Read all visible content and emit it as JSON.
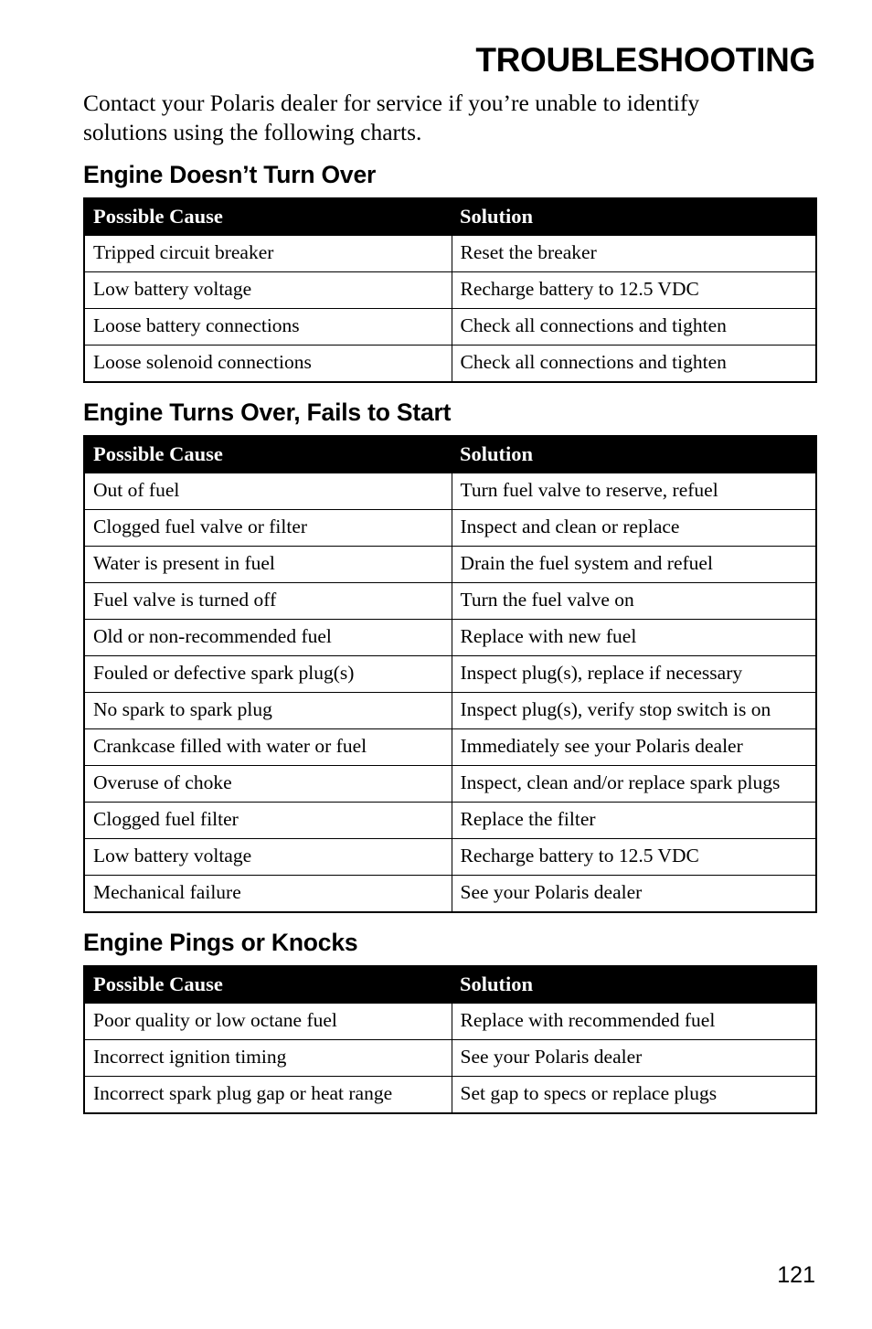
{
  "document": {
    "title": "TROUBLESHOOTING",
    "intro": "Contact your Polaris dealer for service if you’re unable to identify solutions using the following charts.",
    "page_number": "121"
  },
  "table_headers": {
    "cause": "Possible Cause",
    "solution": "Solution"
  },
  "sections": [
    {
      "heading": "Engine Doesn’t Turn Over",
      "rows": [
        {
          "cause": "Tripped circuit breaker",
          "solution": "Reset the breaker"
        },
        {
          "cause": "Low battery voltage",
          "solution": "Recharge battery to 12.5 VDC"
        },
        {
          "cause": "Loose battery connections",
          "solution": "Check all connections and tighten"
        },
        {
          "cause": "Loose solenoid connections",
          "solution": "Check all connections and tighten"
        }
      ]
    },
    {
      "heading": "Engine Turns Over, Fails to Start",
      "rows": [
        {
          "cause": "Out of fuel",
          "solution": "Turn fuel valve to reserve, refuel"
        },
        {
          "cause": "Clogged fuel valve or filter",
          "solution": "Inspect and clean or replace"
        },
        {
          "cause": "Water is present in fuel",
          "solution": "Drain the fuel system and refuel"
        },
        {
          "cause": "Fuel valve is turned off",
          "solution": "Turn the fuel valve on"
        },
        {
          "cause": "Old or non-recommended fuel",
          "solution": "Replace with new fuel"
        },
        {
          "cause": "Fouled or defective spark plug(s)",
          "solution": "Inspect plug(s), replace if necessary"
        },
        {
          "cause": "No spark to spark plug",
          "solution": "Inspect plug(s), verify stop switch is on"
        },
        {
          "cause": "Crankcase filled with water or fuel",
          "solution": "Immediately see your Polaris dealer"
        },
        {
          "cause": "Overuse of choke",
          "solution": "Inspect, clean and/or replace spark plugs"
        },
        {
          "cause": "Clogged fuel filter",
          "solution": "Replace the filter"
        },
        {
          "cause": "Low battery voltage",
          "solution": "Recharge battery to 12.5 VDC"
        },
        {
          "cause": "Mechanical failure",
          "solution": "See your Polaris dealer"
        }
      ]
    },
    {
      "heading": "Engine Pings or Knocks",
      "rows": [
        {
          "cause": "Poor quality or low octane fuel",
          "solution": "Replace with recommended fuel"
        },
        {
          "cause": "Incorrect ignition timing",
          "solution": "See your Polaris dealer"
        },
        {
          "cause": "Incorrect spark plug gap or heat range",
          "solution": "Set gap to specs or replace plugs"
        }
      ]
    }
  ],
  "colors": {
    "header_background": "#000000",
    "header_text": "#ffffff",
    "body_text": "#000000",
    "page_background": "#ffffff",
    "border": "#000000"
  }
}
